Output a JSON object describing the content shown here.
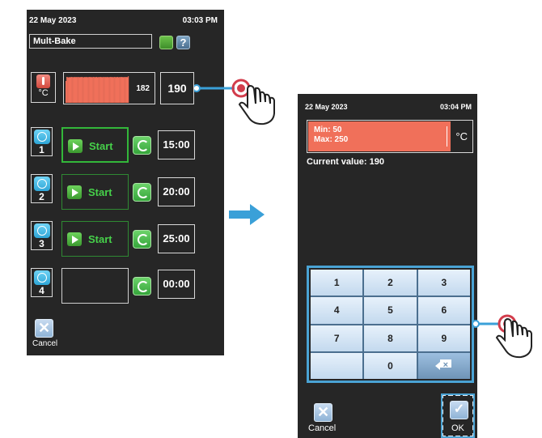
{
  "screen1": {
    "date": "22 May 2023",
    "time": "03:03 PM",
    "program_name": "Mult-Bake",
    "temperature_unit": "°C",
    "current_temp": "182",
    "set_temp": "190",
    "timers": [
      {
        "number": "1",
        "action": "Start",
        "time": "15:00"
      },
      {
        "number": "2",
        "action": "Start",
        "time": "20:00"
      },
      {
        "number": "3",
        "action": "Start",
        "time": "25:00"
      },
      {
        "number": "4",
        "action": "",
        "time": "00:00"
      }
    ],
    "cancel_label": "Cancel"
  },
  "screen2": {
    "date": "22 May 2023",
    "time": "03:04 PM",
    "min_label": "Min: 50",
    "max_label": "Max: 250",
    "unit": "°C",
    "current_value_label": "Current value: 190",
    "keys": [
      "1",
      "2",
      "3",
      "4",
      "5",
      "6",
      "7",
      "8",
      "9",
      "",
      "0",
      "backspace"
    ],
    "cancel_label": "Cancel",
    "ok_label": "OK"
  },
  "colors": {
    "panel_bg": "#262626",
    "accent_green": "#46d04a",
    "accent_blue": "#3aa0d8",
    "temp_fill": "#f0705a"
  },
  "chart_data": {
    "type": "bar",
    "categories": [],
    "values": [
      150,
      178,
      176,
      174,
      177,
      175,
      178,
      176,
      177,
      175,
      178,
      176,
      177,
      176,
      178,
      175,
      177,
      176,
      178,
      176,
      175,
      177,
      176,
      178,
      175,
      177,
      176,
      178,
      176,
      177,
      175,
      178,
      176,
      177,
      176,
      178,
      175,
      177,
      176,
      178,
      176,
      177,
      175,
      178,
      176,
      177,
      176,
      178,
      175,
      177,
      176,
      178,
      176,
      177,
      175,
      178,
      176,
      177,
      176,
      178,
      175,
      177,
      176,
      178,
      176,
      177,
      175,
      178,
      176,
      177,
      176,
      182
    ],
    "title": "",
    "xlabel": "",
    "ylabel": ""
  }
}
